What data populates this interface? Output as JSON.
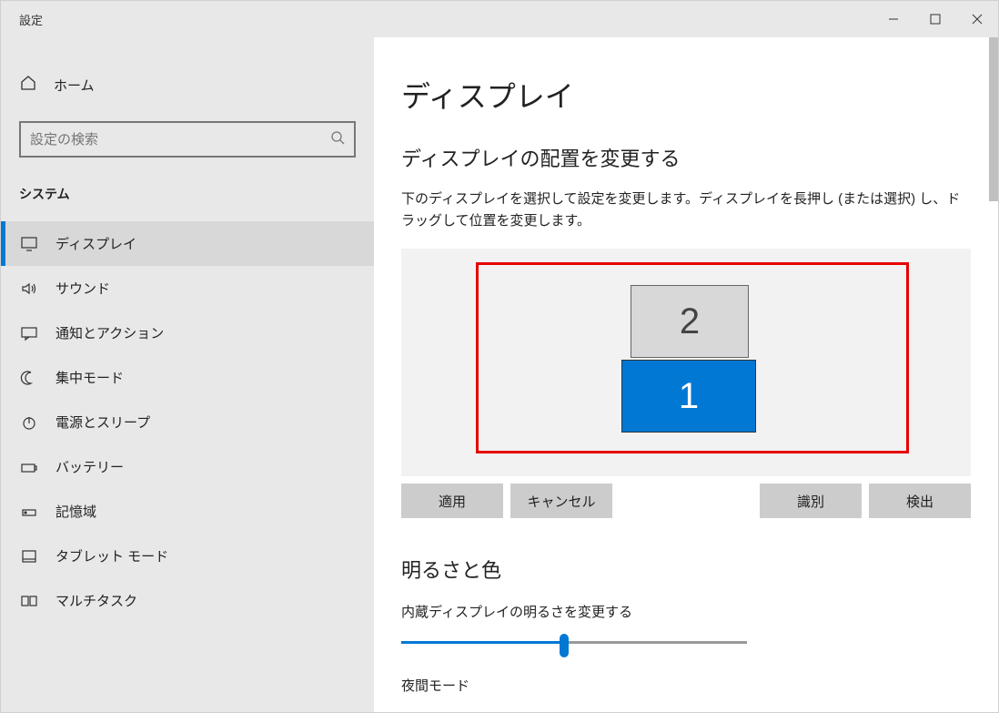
{
  "window": {
    "title": "設定"
  },
  "sidebar": {
    "home": "ホーム",
    "search_placeholder": "設定の検索",
    "category": "システム",
    "items": [
      {
        "label": "ディスプレイ",
        "icon": "monitor"
      },
      {
        "label": "サウンド",
        "icon": "sound"
      },
      {
        "label": "通知とアクション",
        "icon": "message"
      },
      {
        "label": "集中モード",
        "icon": "moon"
      },
      {
        "label": "電源とスリープ",
        "icon": "power"
      },
      {
        "label": "バッテリー",
        "icon": "battery"
      },
      {
        "label": "記憶域",
        "icon": "storage"
      },
      {
        "label": "タブレット モード",
        "icon": "tablet"
      },
      {
        "label": "マルチタスク",
        "icon": "multitask"
      }
    ]
  },
  "main": {
    "title": "ディスプレイ",
    "arrange": {
      "heading": "ディスプレイの配置を変更する",
      "desc": "下のディスプレイを選択して設定を変更します。ディスプレイを長押し (または選択) し、ドラッグして位置を変更します。",
      "monitor1": "1",
      "monitor2": "2",
      "buttons": {
        "apply": "適用",
        "cancel": "キャンセル",
        "identify": "識別",
        "detect": "検出"
      }
    },
    "brightness": {
      "heading": "明るさと色",
      "slider_label": "内蔵ディスプレイの明るさを変更する",
      "night_label": "夜間モード"
    }
  }
}
